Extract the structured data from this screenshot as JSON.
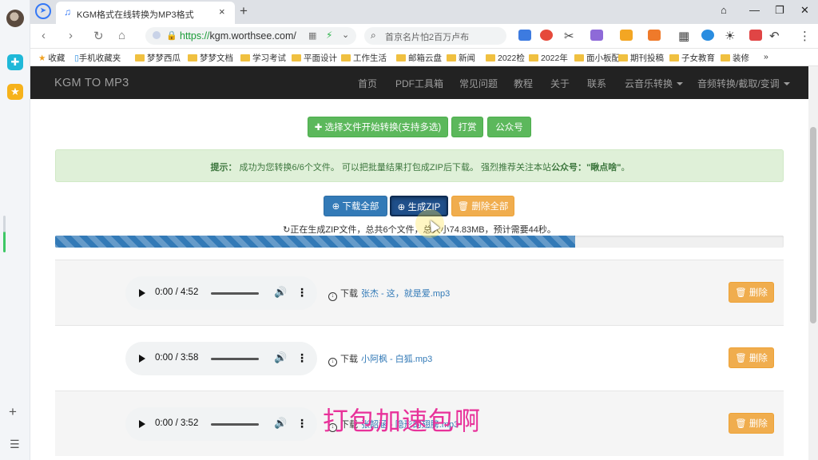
{
  "browser": {
    "tab_title": "KGM格式在线转换为MP3格式",
    "url_scheme": "https://",
    "url_host": "kgm.worthsee.com/",
    "search_placeholder": "首京名片怕2百万卢布",
    "tab_close": "×",
    "new_tab": "+"
  },
  "bookmarks": [
    {
      "label": "收藏",
      "type": "star"
    },
    {
      "label": "手机收藏夹",
      "type": "phone"
    },
    {
      "label": "梦梦西瓜",
      "type": "folder"
    },
    {
      "label": "梦梦文档",
      "type": "folder"
    },
    {
      "label": "学习考试",
      "type": "folder"
    },
    {
      "label": "平面设计",
      "type": "folder"
    },
    {
      "label": "工作生活",
      "type": "folder"
    },
    {
      "label": "邮箱云盘",
      "type": "folder"
    },
    {
      "label": "新闻",
      "type": "folder"
    },
    {
      "label": "2022检",
      "type": "folder"
    },
    {
      "label": "2022年",
      "type": "folder"
    },
    {
      "label": "面小板配",
      "type": "folder"
    },
    {
      "label": "期刊投稿",
      "type": "folder"
    },
    {
      "label": "子女教育",
      "type": "folder"
    },
    {
      "label": "装修",
      "type": "folder"
    },
    {
      "label": "»",
      "type": "more"
    }
  ],
  "site": {
    "brand": "KGM TO MP3",
    "nav": [
      "首页",
      "PDF工具箱",
      "常见问题",
      "教程",
      "关于",
      "联系"
    ],
    "nav_dropdowns": [
      "云音乐转换",
      "音频转换/截取/变调"
    ]
  },
  "actions": {
    "select_files": "✚ 选择文件开始转换(支持多选)",
    "donate": "打赏",
    "wechat": "公众号"
  },
  "alert": {
    "label": "提示：",
    "message": " 成功为您转换6/6个文件。 可以把批量结果打包成ZIP后下载。 强烈推荐关注本站",
    "account_label": "公众号：",
    "account_name": "\"瞅点啥\"",
    "tail": "。"
  },
  "zip": {
    "download_all": "⊕ 下载全部",
    "generate_zip": "⊕ 生成ZIP",
    "delete_all": "🗑 删除全部",
    "status": "↻正在生成ZIP文件，总共6个文件，总大小74.83MB，预计需要44秒。",
    "progress": 0.714
  },
  "files": [
    {
      "time": "0:00 / 4:52",
      "download_label": "下载",
      "name": "张杰 - 这，就是爱.mp3",
      "delete": "🗑 删除"
    },
    {
      "time": "0:00 / 3:58",
      "download_label": "下载",
      "name": "小阿枫 - 白狐.mp3",
      "delete": "🗑 删除"
    },
    {
      "time": "0:00 / 3:52",
      "download_label": "下载",
      "name": "张韶涵 - 隐形的翅膀.mp3",
      "delete": "🗑 删除"
    }
  ],
  "caption": "打包加速包啊",
  "colors": {
    "navbar": "#222222",
    "btn_green": "#5cb85c",
    "btn_blue": "#337ab7",
    "btn_orange": "#f0ad4e",
    "alert_bg": "#dff0d8",
    "caption": "#e8329a"
  }
}
